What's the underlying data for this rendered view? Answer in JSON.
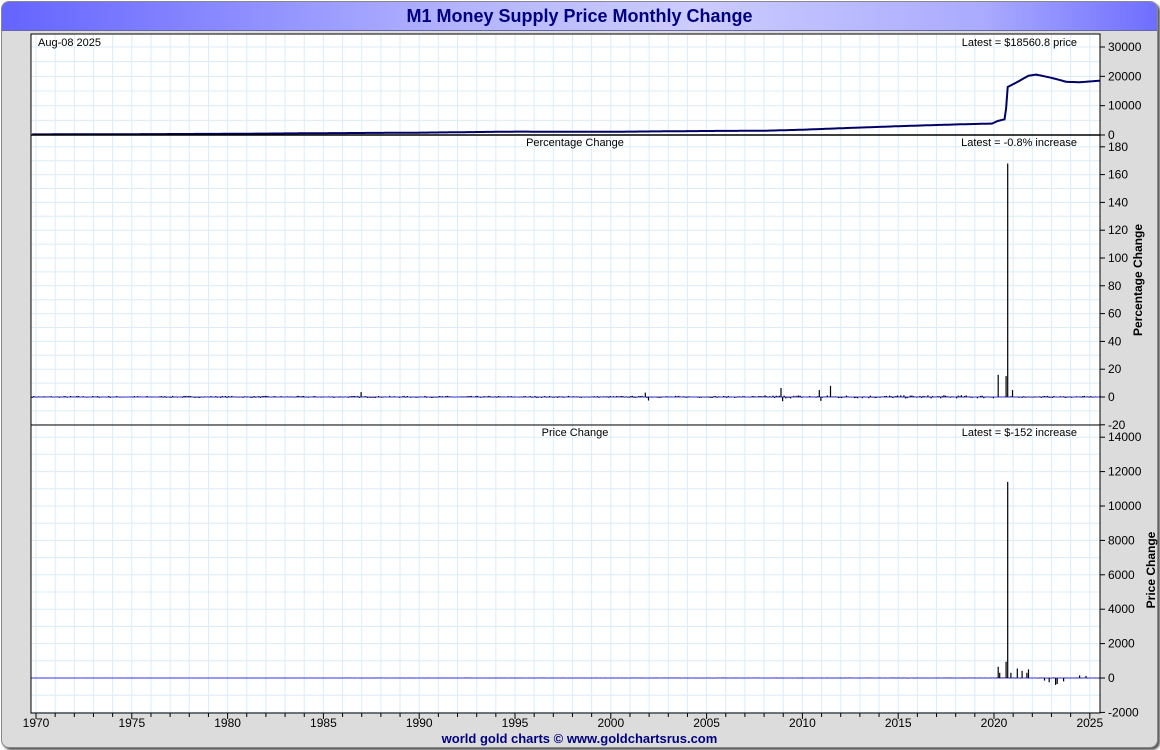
{
  "title": "M1 Money Supply Price Monthly Change",
  "footer": "world gold charts © www.goldchartsrus.com",
  "colors": {
    "line": "#000066",
    "bars": "#000000",
    "zero_line": "#3333ff",
    "grid": "#dcecf8"
  },
  "chart_data": [
    {
      "type": "line",
      "date_label": "Aug-08  2025",
      "latest_label": "Latest = $18560.8 price",
      "ylim": [
        0,
        30000
      ],
      "yticks": [
        0,
        10000,
        20000,
        30000
      ],
      "anchors_x": [
        1970,
        1975,
        1980,
        1985,
        1990,
        1995,
        2000,
        2005,
        2008,
        2010,
        2012,
        2015,
        2018,
        2019.9,
        2020.2,
        2020.6,
        2020.7,
        2021.2,
        2021.8,
        2022.2,
        2023,
        2023.8,
        2024.5,
        2025.6
      ],
      "anchors_y": [
        210,
        280,
        400,
        620,
        800,
        1150,
        1100,
        1370,
        1450,
        1800,
        2300,
        3000,
        3600,
        3900,
        4800,
        5400,
        16300,
        18000,
        20200,
        20600,
        19500,
        18100,
        18000,
        18560.8
      ]
    },
    {
      "type": "bar",
      "title": "Percentage Change",
      "latest_label": "Latest = -0.8% increase",
      "ylabel": "Percentage Change",
      "ylim": [
        -20,
        180
      ],
      "yticks": [
        -20,
        0,
        20,
        40,
        60,
        80,
        100,
        120,
        140,
        160,
        180
      ],
      "spikes": [
        [
          1987.0,
          3.5
        ],
        [
          2001.8,
          3.2
        ],
        [
          2002.0,
          -2.5
        ],
        [
          2008.9,
          6.5
        ],
        [
          2009.0,
          -3
        ],
        [
          2010.9,
          5
        ],
        [
          2011.0,
          -2.8
        ],
        [
          2011.5,
          8
        ],
        [
          2020.2,
          16
        ],
        [
          2020.6,
          15
        ],
        [
          2020.75,
          168
        ],
        [
          2021.0,
          5
        ]
      ],
      "noise_amplitude": 1.5,
      "latest": -0.8
    },
    {
      "type": "bar",
      "title": "Price Change",
      "latest_label": "Latest = $-152 increase",
      "ylabel": "Price Change",
      "ylim": [
        -2000,
        14000
      ],
      "yticks": [
        -2000,
        0,
        2000,
        4000,
        6000,
        8000,
        10000,
        12000,
        14000
      ],
      "spikes": [
        [
          2020.2,
          650
        ],
        [
          2020.3,
          300
        ],
        [
          2020.6,
          950
        ],
        [
          2020.75,
          11400
        ],
        [
          2020.9,
          300
        ],
        [
          2021.2,
          550
        ],
        [
          2021.5,
          420
        ],
        [
          2021.7,
          300
        ],
        [
          2021.8,
          500
        ],
        [
          2022.6,
          -150
        ],
        [
          2022.9,
          -250
        ],
        [
          2023.2,
          -400
        ],
        [
          2023.3,
          -350
        ],
        [
          2023.6,
          -200
        ],
        [
          2024.5,
          150
        ],
        [
          2024.8,
          120
        ],
        [
          2025.6,
          -152
        ]
      ],
      "noise_amplitude": 30,
      "latest": -152
    }
  ],
  "xaxis": {
    "ticks": [
      "1970",
      "1975",
      "1980",
      "1985",
      "1990",
      "1995",
      "2000",
      "2005",
      "2010",
      "2015",
      "2020",
      "2025"
    ],
    "xlim": [
      1969.8,
      2025.5
    ]
  }
}
